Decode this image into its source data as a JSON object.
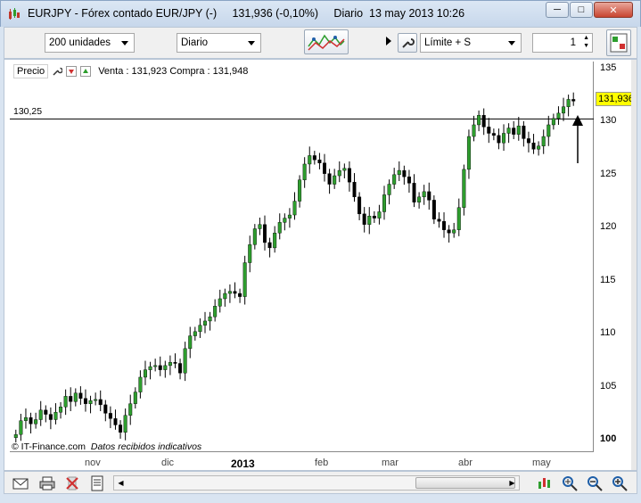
{
  "window": {
    "title": "EURJPY - Fórex contado EUR/JPY (-)     131,936 (-0,10%)     Diario  13 may 2013 10:26",
    "minimize": "─",
    "maximize": "□",
    "close": "✕"
  },
  "toolbar": {
    "units": "200 unidades",
    "period": "Diario",
    "order_type": "Límite + S",
    "quantity": "1"
  },
  "chart": {
    "legend_label": "Precio",
    "quote": "Venta : 131,923 Compra : 131,948",
    "level_label": "130,25",
    "price_tag": "131,936",
    "y_labels": [
      "135",
      "130",
      "125",
      "120",
      "115",
      "110",
      "105",
      "100"
    ],
    "x_labels": [
      "nov",
      "dic",
      "2013",
      "feb",
      "mar",
      "abr",
      "may"
    ],
    "copyright": "© IT-Finance.com",
    "data_note": "Datos recibidos indicativos"
  },
  "colors": {
    "up": "#2e9e2e",
    "down": "#000000",
    "price_tag": "#ffff00",
    "accent": "#1f5fa8"
  },
  "chart_data": {
    "type": "candlestick",
    "ylim": [
      99,
      135.5
    ],
    "level": 130.25,
    "last": 131.936,
    "y_ticks": [
      135,
      130,
      125,
      120,
      115,
      110,
      105,
      100
    ],
    "x_ticks": [
      "nov",
      "dic",
      "2013",
      "feb",
      "mar",
      "abr",
      "may"
    ],
    "closes": [
      100.5,
      101.8,
      102.1,
      101.5,
      101.9,
      102.8,
      102.4,
      101.9,
      102.6,
      103.1,
      104.1,
      103.6,
      104.4,
      103.9,
      103.4,
      103.7,
      103.8,
      103.3,
      102.5,
      102.0,
      101.4,
      100.7,
      102.3,
      103.4,
      104.5,
      105.9,
      106.6,
      106.9,
      107.0,
      106.6,
      107.0,
      107.3,
      107.2,
      106.3,
      108.6,
      109.8,
      110.2,
      110.8,
      111.2,
      111.6,
      112.6,
      113.3,
      113.8,
      114.0,
      113.8,
      113.5,
      116.7,
      118.4,
      119.9,
      120.3,
      118.6,
      118.1,
      119.5,
      120.5,
      120.9,
      121.2,
      122.5,
      124.5,
      126.0,
      126.8,
      126.4,
      126.1,
      125.1,
      124.1,
      124.9,
      125.4,
      125.6,
      124.3,
      122.9,
      121.3,
      120.3,
      121.1,
      120.9,
      121.5,
      123.1,
      124.1,
      125.0,
      125.4,
      124.8,
      124.2,
      122.4,
      122.9,
      123.4,
      122.6,
      120.8,
      120.6,
      119.8,
      119.5,
      119.8,
      121.9,
      125.5,
      128.6,
      129.7,
      130.6,
      129.5,
      128.9,
      128.7,
      128.0,
      128.9,
      129.4,
      128.8,
      129.6,
      128.4,
      128.0,
      127.4,
      127.7,
      128.6,
      129.7,
      130.3,
      130.8,
      131.4,
      132.1,
      131.936
    ]
  }
}
